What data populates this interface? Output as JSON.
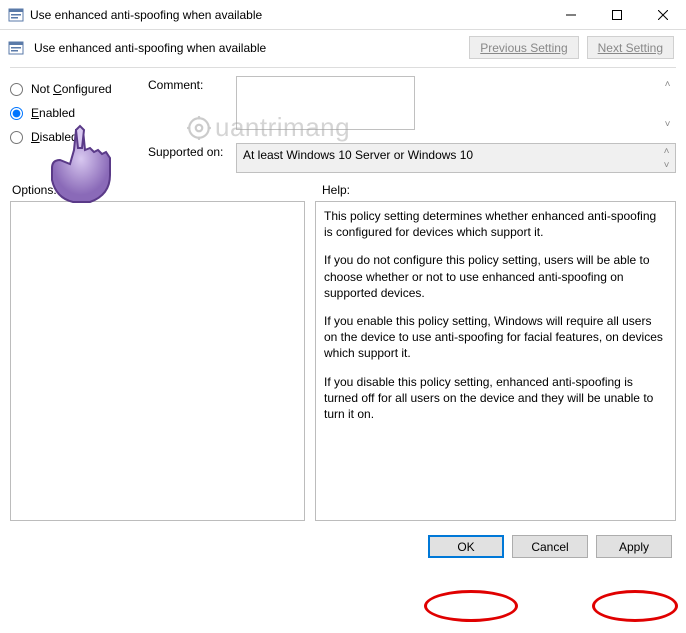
{
  "titlebar": {
    "title": "Use enhanced anti-spoofing when available"
  },
  "header": {
    "title": "Use enhanced anti-spoofing when available",
    "prev": "Previous Setting",
    "next": "Next Setting"
  },
  "radios": {
    "not_configured": "Not Configured",
    "enabled": "Enabled",
    "disabled": "Disabled"
  },
  "fields": {
    "comment_label": "Comment:",
    "comment_value": "",
    "supported_label": "Supported on:",
    "supported_value": "At least Windows 10 Server or Windows 10"
  },
  "labels": {
    "options": "Options:",
    "help": "Help:"
  },
  "help": {
    "p1": "This policy setting determines whether enhanced anti-spoofing is configured for devices which support it.",
    "p2": "If you do not configure this policy setting, users will be able to choose whether or not to use enhanced anti-spoofing on supported devices.",
    "p3": "If you enable this policy setting, Windows will require all users on the device to use anti-spoofing for facial features, on devices which support it.",
    "p4": "If you disable this policy setting, enhanced anti-spoofing is turned off for all users on the device and they will be unable to turn it on."
  },
  "footer": {
    "ok": "OK",
    "cancel": "Cancel",
    "apply": "Apply"
  },
  "watermark": "uantrimang"
}
